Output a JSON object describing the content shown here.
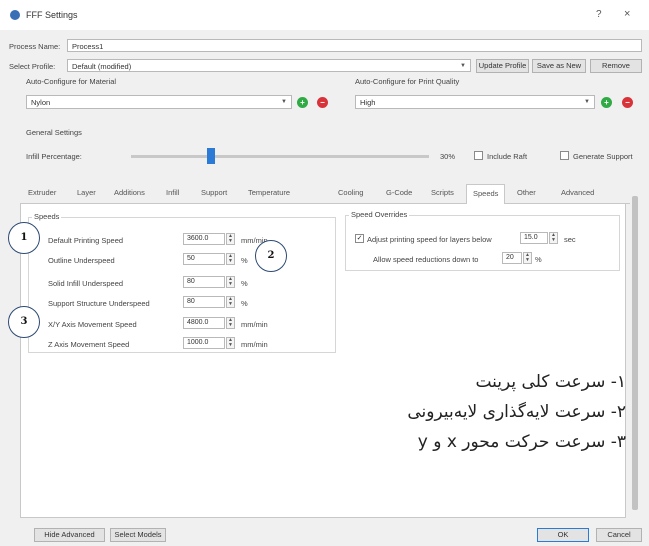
{
  "window": {
    "title": "FFF Settings",
    "help_label": "?",
    "close_label": "×"
  },
  "process": {
    "name_label": "Process Name:",
    "name_value": "Process1",
    "profile_label": "Select Profile:",
    "profile_value": "Default (modified)",
    "update_profile": "Update Profile",
    "save_as_new": "Save as New",
    "remove": "Remove"
  },
  "material": {
    "label": "Auto-Configure for Material",
    "value": "Nylon"
  },
  "quality": {
    "label": "Auto-Configure for Print Quality",
    "value": "High"
  },
  "general": {
    "label": "General Settings",
    "infill_label": "Infill Percentage:",
    "infill_value": "30%",
    "infill_fraction": 0.3,
    "include_raft": "Include Raft",
    "generate_support": "Generate Support"
  },
  "tabs": [
    "Extruder",
    "Layer",
    "Additions",
    "Infill",
    "Support",
    "Temperature",
    "Cooling",
    "G-Code",
    "Scripts",
    "Speeds",
    "Other",
    "Advanced"
  ],
  "active_tab": "Speeds",
  "speeds": {
    "legend": "Speeds",
    "rows": [
      {
        "label": "Default Printing Speed",
        "value": "3600.0",
        "unit": "mm/min"
      },
      {
        "label": "Outline Underspeed",
        "value": "50",
        "unit": "%"
      },
      {
        "label": "Solid Infill Underspeed",
        "value": "80",
        "unit": "%"
      },
      {
        "label": "Support Structure Underspeed",
        "value": "80",
        "unit": "%"
      },
      {
        "label": "X/Y Axis Movement Speed",
        "value": "4800.0",
        "unit": "mm/min"
      },
      {
        "label": "Z Axis Movement Speed",
        "value": "1000.0",
        "unit": "mm/min"
      }
    ]
  },
  "overrides": {
    "legend": "Speed Overrides",
    "adjust_label": "Adjust printing speed for layers below",
    "adjust_value": "15.0",
    "adjust_unit": "sec",
    "allow_label": "Allow speed reductions down to",
    "allow_value": "20",
    "allow_unit": "%"
  },
  "callouts": [
    "1",
    "2",
    "3"
  ],
  "notes": [
    "۱- سرعت کلی پرینت",
    "۲- سرعت لایه‌گذاری لایه‌بیرونی",
    "۳- سرعت حرکت محور x و y"
  ],
  "footer": {
    "hide_advanced": "Hide Advanced",
    "select_models": "Select Models",
    "ok": "OK",
    "cancel": "Cancel"
  },
  "colors": {
    "accent": "#2a7ad6",
    "add_button": "#2faa44",
    "remove_button": "#d9333a",
    "callout_border": "#2c4a73"
  }
}
